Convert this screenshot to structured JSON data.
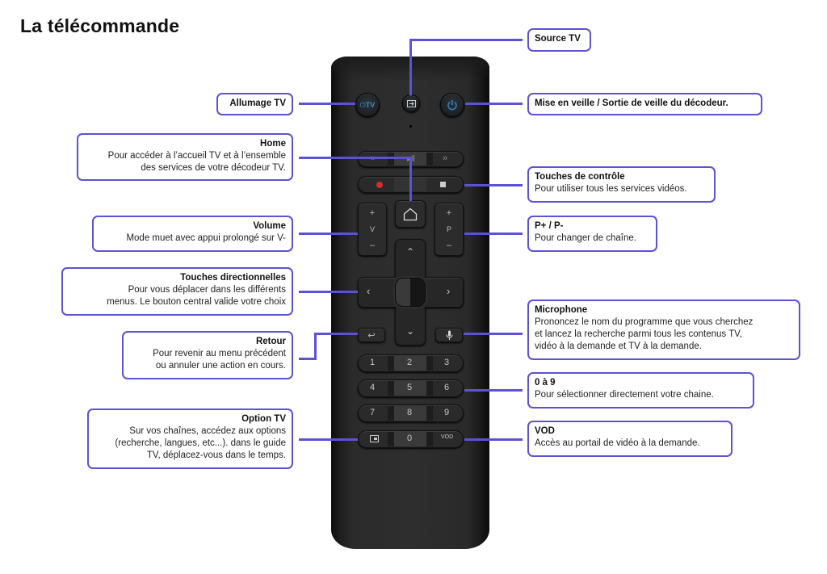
{
  "title": "La télécommande",
  "colors": {
    "accent": "#5b52d6",
    "record": "#d42b2b",
    "power_icon": "#2e8fd8"
  },
  "remote": {
    "tv_button_label": "TV",
    "volume": {
      "plus": "+",
      "label": "V",
      "minus": "–"
    },
    "program": {
      "plus": "+",
      "label": "P",
      "minus": "–"
    },
    "digits": [
      "1",
      "2",
      "3",
      "4",
      "5",
      "6",
      "7",
      "8",
      "9",
      "0"
    ],
    "vod_label": "VOD",
    "icons": [
      "power-icon",
      "source-icon",
      "rewind-icon",
      "play-pause-icon",
      "fast-forward-icon",
      "record-icon",
      "stop-icon",
      "home-icon",
      "up-icon",
      "left-icon",
      "ok-icon",
      "right-icon",
      "down-icon",
      "back-icon",
      "mic-icon",
      "option-icon"
    ]
  },
  "callouts": {
    "source": {
      "title": "Source TV",
      "desc": ""
    },
    "allumage": {
      "title": "Allumage TV",
      "desc": ""
    },
    "veille": {
      "title": "Mise en veille / Sortie de veille du décodeur.",
      "desc": ""
    },
    "home": {
      "title": "Home",
      "desc": "Pour accéder à l’accueil TV et à l’ensemble\ndes services de votre décodeur TV."
    },
    "controle": {
      "title": "Touches de contrôle",
      "desc": "Pour utiliser tous les services vidéos."
    },
    "volume": {
      "title": "Volume",
      "desc": "Mode muet avec appui prolongé sur V-"
    },
    "programme": {
      "title": "P+ / P-",
      "desc": "Pour changer de chaîne."
    },
    "directionnelles": {
      "title": "Touches directionnelles",
      "desc": "Pour vous déplacer dans les différents\nmenus. Le bouton central valide votre choix"
    },
    "microphone": {
      "title": "Microphone",
      "desc": "Prononcez le nom du programme que vous cherchez\net lancez la recherche parmi tous les contenus TV,\nvidéo à la demande et TV à la demande."
    },
    "retour": {
      "title": "Retour",
      "desc": "Pour revenir au menu précédent\nou annuler une action en cours."
    },
    "chiffres": {
      "title": "0 à 9",
      "desc": "Pour sélectionner directement votre chaine."
    },
    "option": {
      "title": "Option TV",
      "desc": "Sur vos chaînes, accédez aux options\n(recherche, langues, etc...). dans le guide\nTV, déplacez-vous dans le temps."
    },
    "vod": {
      "title": "VOD",
      "desc": "Accès au portail de vidéo à la demande."
    }
  }
}
